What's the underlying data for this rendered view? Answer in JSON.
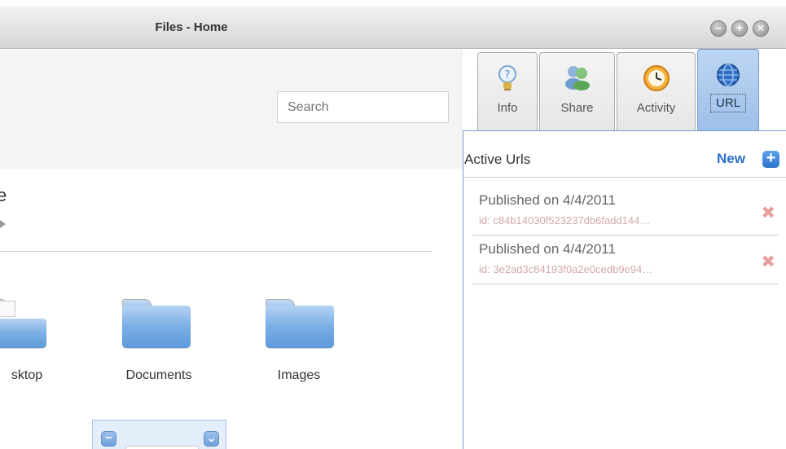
{
  "window": {
    "title": "Files - Home",
    "controls": [
      "minimize",
      "maximize",
      "close"
    ]
  },
  "search": {
    "placeholder": "Search"
  },
  "main": {
    "heading": "e",
    "folders": [
      {
        "label": "sktop",
        "icon": "folder-open-icon"
      },
      {
        "label": "Documents",
        "icon": "folder-icon"
      },
      {
        "label": "Images",
        "icon": "folder-icon"
      }
    ],
    "mini_panel": {
      "left_btn": "−",
      "right_btn": "⌄"
    }
  },
  "side_panel": {
    "tabs": [
      {
        "label": "Info",
        "icon": "lightbulb-icon"
      },
      {
        "label": "Share",
        "icon": "users-icon"
      },
      {
        "label": "Activity",
        "icon": "clock-icon"
      },
      {
        "label": "URL",
        "icon": "globe-icon",
        "active": true
      }
    ],
    "section_title": "Active Urls",
    "new_label": "New",
    "urls": [
      {
        "published": "Published on 4/4/2011",
        "id": "id: c84b14030f523237db6fadd144…"
      },
      {
        "published": "Published on 4/4/2011",
        "id": "id: 3e2ad3c84193f0a2e0cedb9e94…"
      }
    ]
  },
  "colors": {
    "accent": "#2a6fc9",
    "active_tab": "#9dbfe9",
    "delete": "#e9a0a0"
  }
}
